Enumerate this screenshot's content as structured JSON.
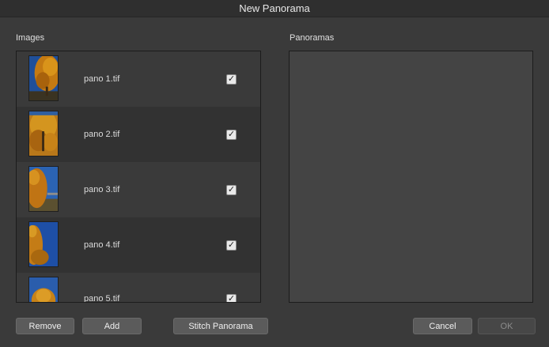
{
  "window": {
    "title": "New Panorama"
  },
  "images": {
    "label": "Images",
    "items": [
      {
        "filename": "pano 1.tif",
        "checked": true,
        "check_glyph": "✓"
      },
      {
        "filename": "pano 2.tif",
        "checked": true,
        "check_glyph": "✓"
      },
      {
        "filename": "pano 3.tif",
        "checked": true,
        "check_glyph": "✓"
      },
      {
        "filename": "pano 4.tif",
        "checked": true,
        "check_glyph": "✓"
      },
      {
        "filename": "pano 5.tif",
        "checked": true,
        "check_glyph": "✓"
      }
    ]
  },
  "panoramas": {
    "label": "Panoramas"
  },
  "buttons": {
    "remove": "Remove",
    "add": "Add",
    "stitch": "Stitch Panorama",
    "cancel": "Cancel",
    "ok": "OK"
  },
  "colors": {
    "window_bg": "#3a3a3a",
    "list_bg": "#2e2e2e",
    "button_bg": "#5b5b5b"
  }
}
